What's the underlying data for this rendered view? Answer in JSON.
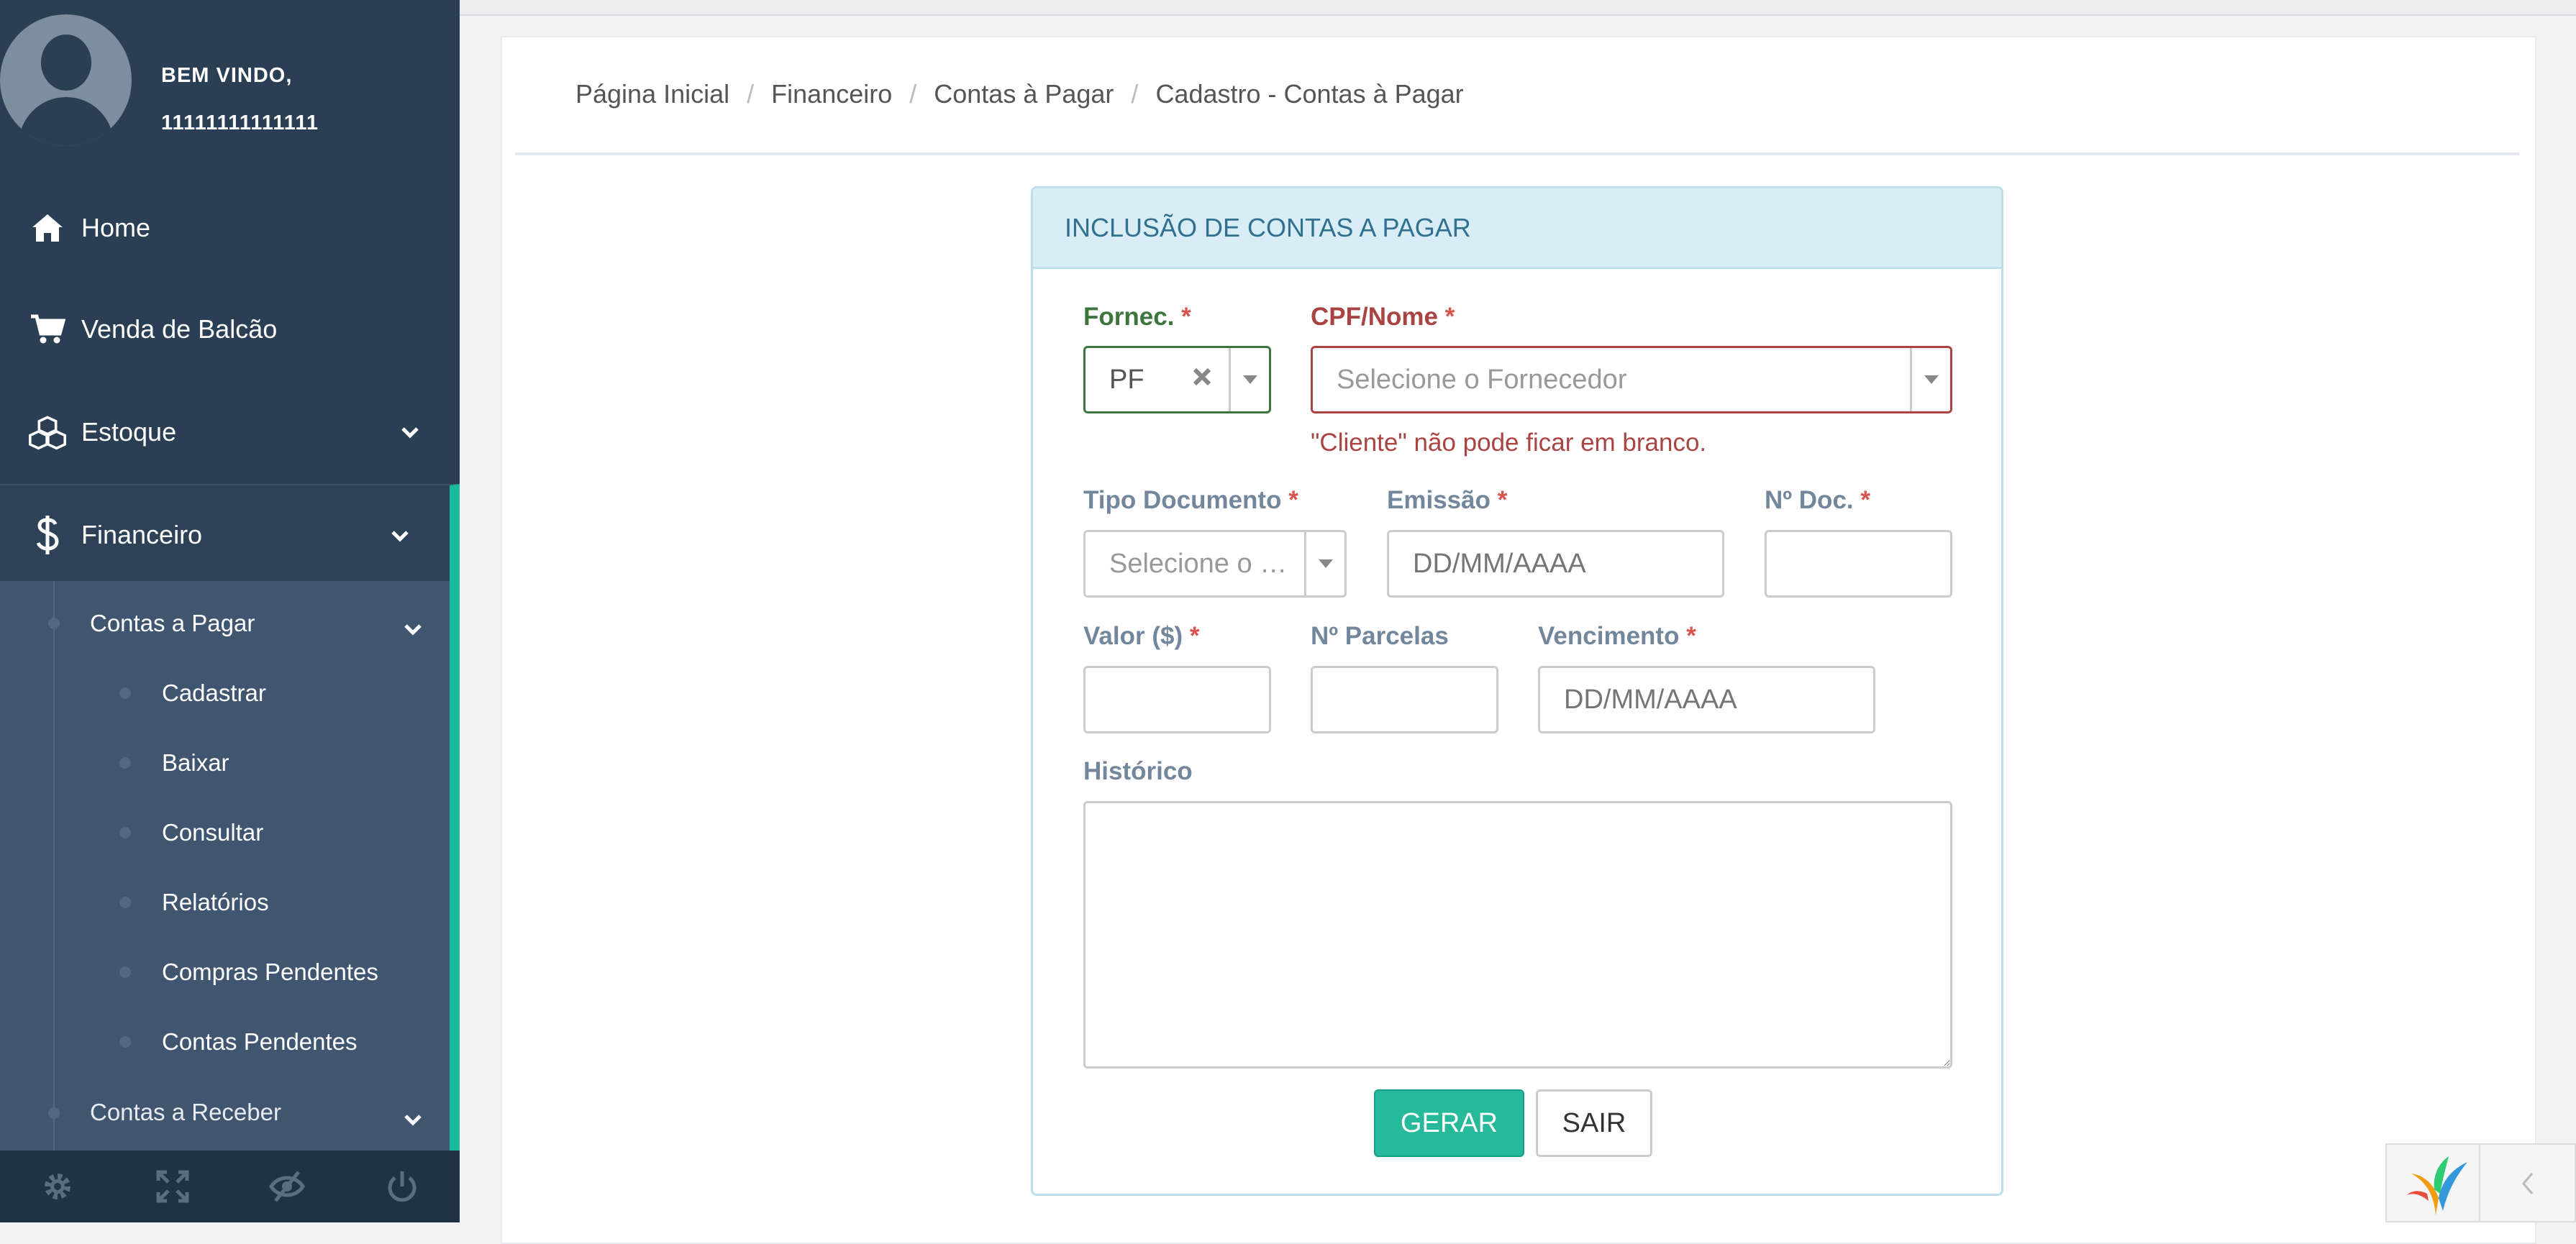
{
  "sidebar": {
    "welcome": "BEM VINDO,",
    "username": "11111111111111",
    "items": [
      {
        "label": "Home",
        "icon": "home-icon"
      },
      {
        "label": "Venda de Balcão",
        "icon": "cart-icon"
      },
      {
        "label": "Estoque",
        "icon": "cubes-icon"
      },
      {
        "label": "Financeiro",
        "icon": "dollar-icon"
      }
    ],
    "submenu": {
      "contas_pagar": "Contas a Pagar",
      "children": [
        "Cadastrar",
        "Baixar",
        "Consultar",
        "Relatórios",
        "Compras Pendentes",
        "Contas Pendentes"
      ],
      "contas_receber": "Contas a Receber"
    },
    "footer_icons": [
      "gear-icon",
      "fullscreen-icon",
      "eye-slash-icon",
      "power-icon"
    ]
  },
  "breadcrumb": [
    "Página Inicial",
    "Financeiro",
    "Contas à Pagar",
    "Cadastro - Contas à Pagar"
  ],
  "form": {
    "title": "INCLUSÃO DE CONTAS A PAGAR",
    "fornec_label": "Fornec.",
    "fornec_value": "PF",
    "cpf_label": "CPF/Nome",
    "cpf_placeholder": "Selecione o Fornecedor",
    "cpf_error": "\"Cliente\" não pode ficar em branco.",
    "tipo_label": "Tipo Documento",
    "tipo_placeholder": "Selecione o …",
    "emissao_label": "Emissão",
    "emissao_placeholder": "DD/MM/AAAA",
    "ndoc_label": "Nº Doc.",
    "valor_label": "Valor ($)",
    "parcelas_label": "Nº Parcelas",
    "vencimento_label": "Vencimento",
    "vencimento_placeholder": "DD/MM/AAAA",
    "historico_label": "Histórico",
    "required_mark": "*",
    "gerar": "GERAR",
    "sair": "SAIR"
  },
  "colors": {
    "sidebar": "#2a3f54",
    "accent": "#1abb9c",
    "error": "#a94442",
    "success": "#3c763d"
  }
}
